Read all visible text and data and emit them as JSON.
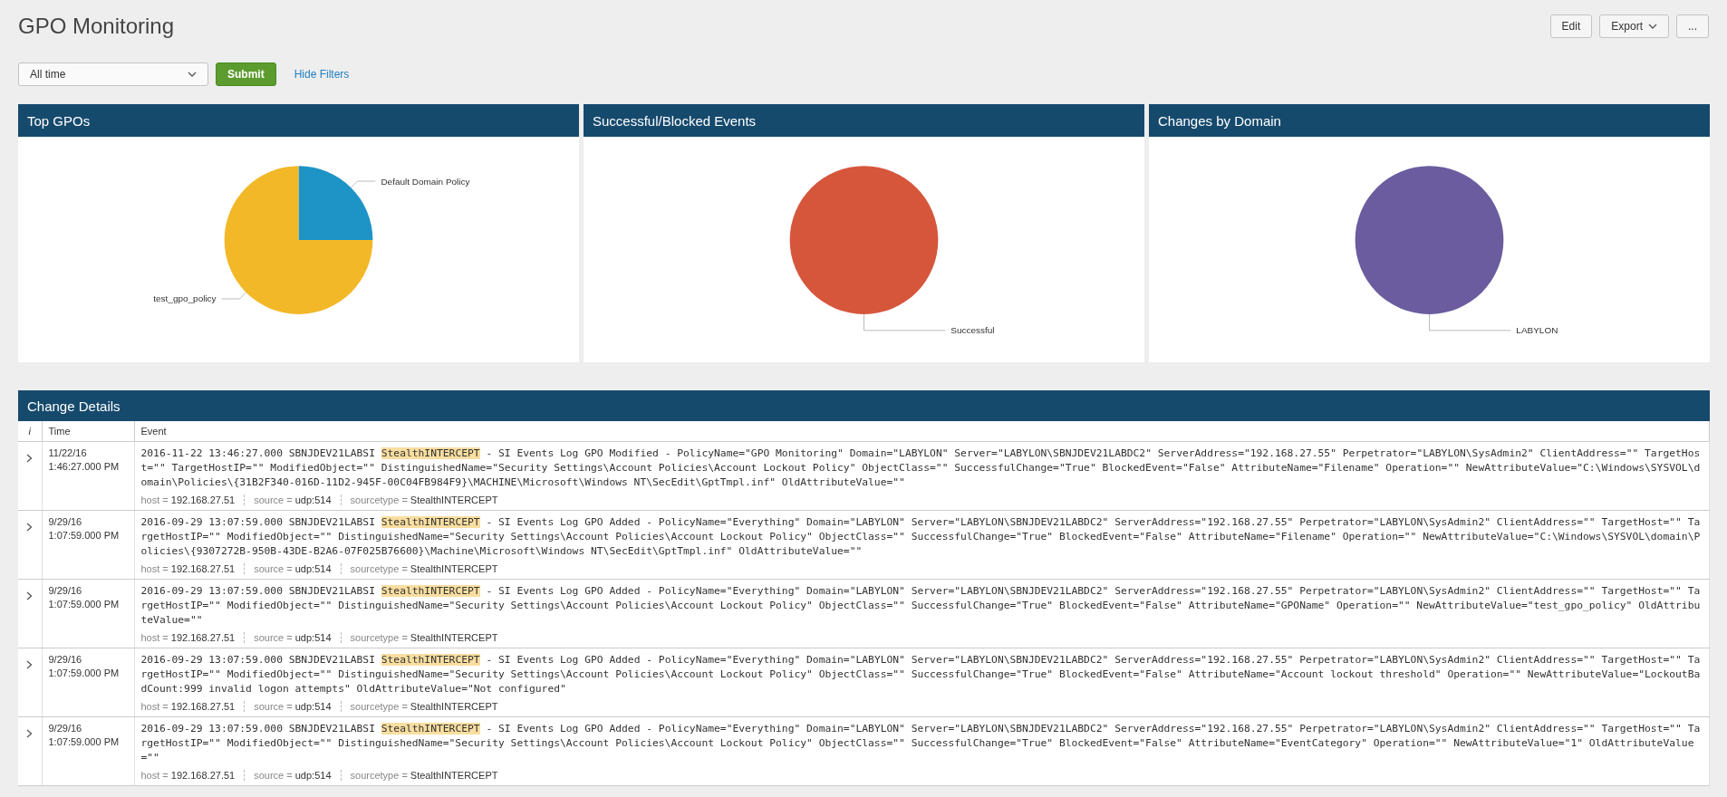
{
  "title": "GPO Monitoring",
  "header_buttons": [
    {
      "kind": "plain",
      "label": "Edit"
    },
    {
      "kind": "dropdown",
      "label": "Export"
    },
    {
      "kind": "plain",
      "label": "..."
    }
  ],
  "filters": {
    "time_range": "All time",
    "submit": "Submit",
    "hide_link": "Hide Filters"
  },
  "panels": [
    {
      "title": "Top GPOs",
      "chart_data": {
        "type": "pie",
        "categories": [
          "Default Domain Policy",
          "test_gpo_policy"
        ],
        "values": [
          25,
          75
        ],
        "colors": [
          "#1e93c6",
          "#f2b827"
        ]
      }
    },
    {
      "title": "Successful/Blocked Events",
      "chart_data": {
        "type": "pie",
        "categories": [
          "Successful"
        ],
        "values": [
          100
        ],
        "colors": [
          "#d6563c"
        ]
      }
    },
    {
      "title": "Changes by Domain",
      "chart_data": {
        "type": "pie",
        "categories": [
          "LABYLON"
        ],
        "values": [
          100
        ],
        "colors": [
          "#6a5c9e"
        ]
      }
    }
  ],
  "change_details": {
    "title": "Change Details",
    "columns": [
      "i",
      "Time",
      "Event"
    ],
    "rows": [
      {
        "date": "11/22/16",
        "time": "1:46:27.000 PM",
        "event_before": "2016-11-22 13:46:27.000 SBNJDEV21LABSI ",
        "event_highlight": "StealthINTERCEPT",
        "event_after": " - SI Events Log GPO Modified - PolicyName=\"GPO Monitoring\" Domain=\"LABYLON\" Server=\"LABYLON\\SBNJDEV21LABDC2\" ServerAddress=\"192.168.27.55\" Perpetrator=\"LABYLON\\SysAdmin2\" ClientAddress=\"\" TargetHost=\"\" TargetHostIP=\"\" ModifiedObject=\"\" DistinguishedName=\"Security Settings\\Account Policies\\Account Lockout Policy\" ObjectClass=\"\" SuccessfulChange=\"True\" BlockedEvent=\"False\" AttributeName=\"Filename\" Operation=\"\" NewAttributeValue=\"C:\\Windows\\SYSVOL\\domain\\Policies\\{31B2F340-016D-11D2-945F-00C04FB984F9}\\MACHINE\\Microsoft\\Windows NT\\SecEdit\\GptTmpl.inf\" OldAttributeValue=\"\"",
        "fields": [
          {
            "key": "host =",
            "value": "192.168.27.51"
          },
          {
            "key": "source =",
            "value": "udp:514"
          },
          {
            "key": "sourcetype =",
            "value": "StealthINTERCEPT"
          }
        ]
      },
      {
        "date": "9/29/16",
        "time": "1:07:59.000 PM",
        "event_before": "2016-09-29 13:07:59.000 SBNJDEV21LABSI ",
        "event_highlight": "StealthINTERCEPT",
        "event_after": " - SI Events Log GPO Added - PolicyName=\"Everything\" Domain=\"LABYLON\" Server=\"LABYLON\\SBNJDEV21LABDC2\" ServerAddress=\"192.168.27.55\" Perpetrator=\"LABYLON\\SysAdmin2\" ClientAddress=\"\" TargetHost=\"\" TargetHostIP=\"\" ModifiedObject=\"\" DistinguishedName=\"Security Settings\\Account Policies\\Account Lockout Policy\" ObjectClass=\"\" SuccessfulChange=\"True\" BlockedEvent=\"False\" AttributeName=\"Filename\" Operation=\"\" NewAttributeValue=\"C:\\Windows\\SYSVOL\\domain\\Policies\\{9307272B-950B-43DE-B2A6-07F025B76600}\\Machine\\Microsoft\\Windows NT\\SecEdit\\GptTmpl.inf\" OldAttributeValue=\"\"",
        "fields": [
          {
            "key": "host =",
            "value": "192.168.27.51"
          },
          {
            "key": "source =",
            "value": "udp:514"
          },
          {
            "key": "sourcetype =",
            "value": "StealthINTERCEPT"
          }
        ]
      },
      {
        "date": "9/29/16",
        "time": "1:07:59.000 PM",
        "event_before": "2016-09-29 13:07:59.000 SBNJDEV21LABSI ",
        "event_highlight": "StealthINTERCEPT",
        "event_after": " - SI Events Log GPO Added - PolicyName=\"Everything\" Domain=\"LABYLON\" Server=\"LABYLON\\SBNJDEV21LABDC2\" ServerAddress=\"192.168.27.55\" Perpetrator=\"LABYLON\\SysAdmin2\" ClientAddress=\"\" TargetHost=\"\" TargetHostIP=\"\" ModifiedObject=\"\" DistinguishedName=\"Security Settings\\Account Policies\\Account Lockout Policy\" ObjectClass=\"\" SuccessfulChange=\"True\" BlockedEvent=\"False\" AttributeName=\"GPOName\" Operation=\"\" NewAttributeValue=\"test_gpo_policy\" OldAttributeValue=\"\"",
        "fields": [
          {
            "key": "host =",
            "value": "192.168.27.51"
          },
          {
            "key": "source =",
            "value": "udp:514"
          },
          {
            "key": "sourcetype =",
            "value": "StealthINTERCEPT"
          }
        ]
      },
      {
        "date": "9/29/16",
        "time": "1:07:59.000 PM",
        "event_before": "2016-09-29 13:07:59.000 SBNJDEV21LABSI ",
        "event_highlight": "StealthINTERCEPT",
        "event_after": " - SI Events Log GPO Added - PolicyName=\"Everything\" Domain=\"LABYLON\" Server=\"LABYLON\\SBNJDEV21LABDC2\" ServerAddress=\"192.168.27.55\" Perpetrator=\"LABYLON\\SysAdmin2\" ClientAddress=\"\" TargetHost=\"\" TargetHostIP=\"\" ModifiedObject=\"\" DistinguishedName=\"Security Settings\\Account Policies\\Account Lockout Policy\" ObjectClass=\"\" SuccessfulChange=\"True\" BlockedEvent=\"False\" AttributeName=\"Account lockout threshold\" Operation=\"\" NewAttributeValue=\"LockoutBadCount:999 invalid logon attempts\" OldAttributeValue=\"Not configured\"",
        "fields": [
          {
            "key": "host =",
            "value": "192.168.27.51"
          },
          {
            "key": "source =",
            "value": "udp:514"
          },
          {
            "key": "sourcetype =",
            "value": "StealthINTERCEPT"
          }
        ]
      },
      {
        "date": "9/29/16",
        "time": "1:07:59.000 PM",
        "event_before": "2016-09-29 13:07:59.000 SBNJDEV21LABSI ",
        "event_highlight": "StealthINTERCEPT",
        "event_after": " - SI Events Log GPO Added - PolicyName=\"Everything\" Domain=\"LABYLON\" Server=\"LABYLON\\SBNJDEV21LABDC2\" ServerAddress=\"192.168.27.55\" Perpetrator=\"LABYLON\\SysAdmin2\" ClientAddress=\"\" TargetHost=\"\" TargetHostIP=\"\" ModifiedObject=\"\" DistinguishedName=\"Security Settings\\Account Policies\\Account Lockout Policy\" ObjectClass=\"\" SuccessfulChange=\"True\" BlockedEvent=\"False\" AttributeName=\"EventCategory\" Operation=\"\" NewAttributeValue=\"1\" OldAttributeValue=\"\"",
        "fields": [
          {
            "key": "host =",
            "value": "192.168.27.51"
          },
          {
            "key": "source =",
            "value": "udp:514"
          },
          {
            "key": "sourcetype =",
            "value": "StealthINTERCEPT"
          }
        ]
      }
    ]
  }
}
